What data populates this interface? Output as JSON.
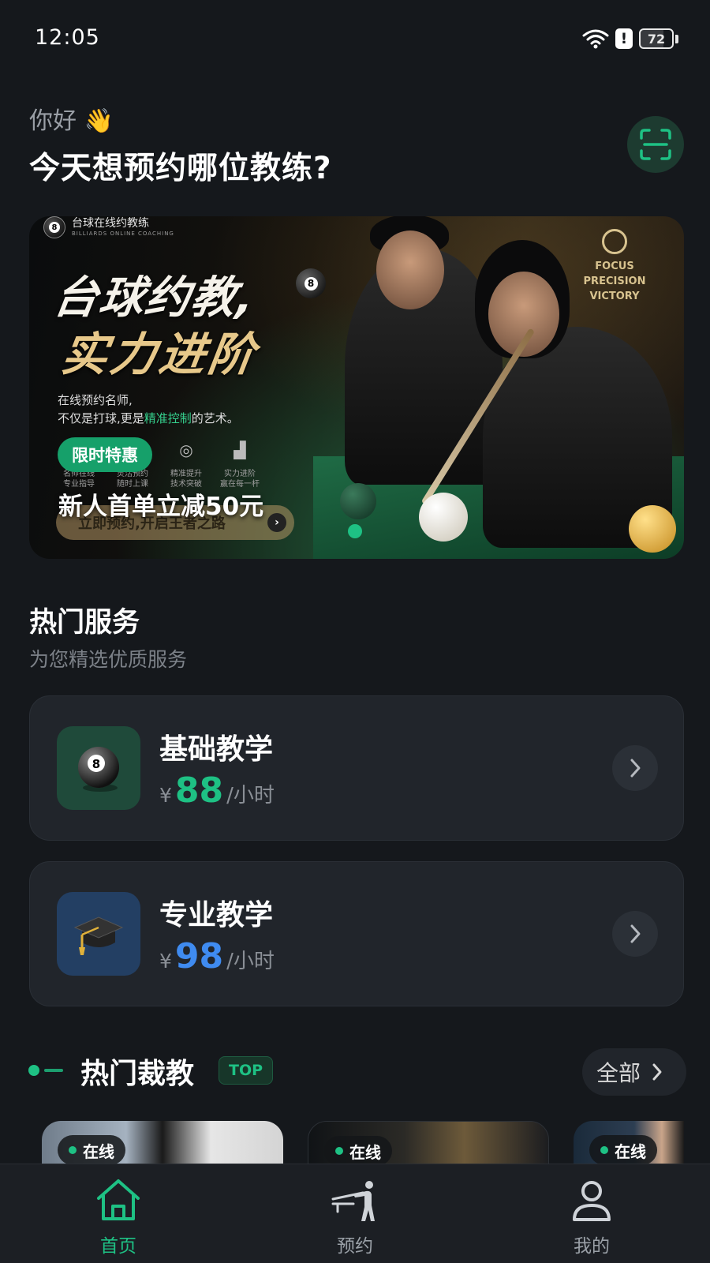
{
  "status_bar": {
    "time": "12:05",
    "battery": "72"
  },
  "greeting": "你好 👋",
  "headline": "今天想预约哪位教练?",
  "banner": {
    "logo_text": "台球在线约教练",
    "logo_sub": "BILLIARDS ONLINE COACHING",
    "title_line1": "台球约教,",
    "title_line2": "实力进阶",
    "desc_line1": "在线预约名师,",
    "desc_line2_a": "不仅是打球,更是",
    "desc_line2_em": "精准控制",
    "desc_line2_b": "的艺术。",
    "emblem_lines": [
      "FOCUS",
      "PRECISION",
      "VICTORY"
    ],
    "features": [
      {
        "line1": "名师在线",
        "line2": "专业指导"
      },
      {
        "line1": "灵活预约",
        "line2": "随时上课"
      },
      {
        "line1": "精准提升",
        "line2": "技术突破"
      },
      {
        "line1": "实力进阶",
        "line2": "赢在每一杆"
      }
    ],
    "pill": "限时特惠",
    "promo": "新人首单立减50元",
    "cta": "立即预约,开启王者之路",
    "ball_number": "8"
  },
  "services": {
    "title": "热门服务",
    "subtitle": "为您精选优质服务",
    "items": [
      {
        "name": "基础教学",
        "currency": "¥",
        "price": "88",
        "unit": "/小时",
        "price_color": "#1ec184",
        "icon": "billiard-8-ball-icon",
        "icon_bg": "#1f4a3a"
      },
      {
        "name": "专业教学",
        "currency": "¥",
        "price": "98",
        "unit": "/小时",
        "price_color": "#3f8bf0",
        "icon": "graduation-cap-icon",
        "icon_bg": "#233f63"
      }
    ]
  },
  "coaches": {
    "title": "热门裁教",
    "badge": "TOP",
    "all_label": "全部",
    "cards": [
      {
        "status": "在线"
      },
      {
        "status": "在线"
      },
      {
        "status": "在线"
      }
    ]
  },
  "tab_bar": {
    "items": [
      {
        "label": "首页",
        "icon": "home-icon",
        "active": true
      },
      {
        "label": "预约",
        "icon": "billiards-player-icon",
        "active": false
      },
      {
        "label": "我的",
        "icon": "user-icon",
        "active": false
      }
    ]
  },
  "colors": {
    "accent": "#1ec184",
    "blue": "#3f8bf0",
    "background": "#15181c",
    "card": "#21252b"
  }
}
